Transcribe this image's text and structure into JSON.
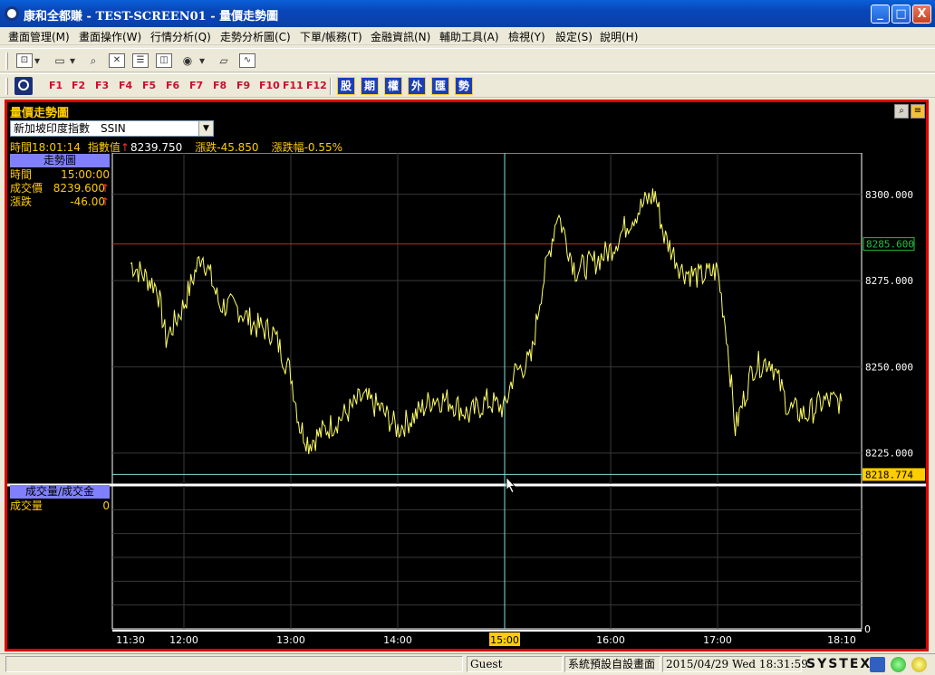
{
  "window": {
    "title": "康和全都賺 - TEST-SCREEN01 - 量價走勢圖",
    "minimize": "_",
    "maximize": "□",
    "close": "X"
  },
  "menu": [
    "畫面管理(M)",
    "畫面操作(W)",
    "行情分析(Q)",
    "走勢分析圖(C)",
    "下單/帳務(T)",
    "金融資訊(N)",
    "輔助工具(A)",
    "檢視(Y)",
    "設定(S)",
    "說明(H)"
  ],
  "toolbar2": {
    "fkeys": [
      "F1",
      "F2",
      "F3",
      "F4",
      "F5",
      "F6",
      "F7",
      "F8",
      "F9",
      "F10",
      "F11",
      "F12"
    ],
    "cat_buttons": [
      "股",
      "期",
      "權",
      "外",
      "匯",
      "勢"
    ]
  },
  "panel": {
    "title": "量價走勢圖",
    "symbol": "新加坡印度指數　SSIN",
    "quote": {
      "time": "時間18:01:14",
      "index_label": "指數值",
      "index_value": "8239.750",
      "change": "漲跌-45.850",
      "change_pct": "漲跌幅-0.55%"
    },
    "trend_head": "走勢圖",
    "trend_rows": [
      {
        "k": "時間",
        "v": "15:00:00"
      },
      {
        "k": "成交價",
        "v": "8239.600"
      },
      {
        "k": "漲跌",
        "v": "-46.00"
      }
    ],
    "volume_head": "成交量/成交金",
    "volume_rows": [
      {
        "k": "成交量",
        "v": "0"
      }
    ]
  },
  "chart_data": {
    "type": "line",
    "title": "",
    "x_ticks": [
      "11:30",
      "12:00",
      "13:00",
      "14:00",
      "15:00",
      "16:00",
      "17:00",
      "18:10"
    ],
    "y_ticks": [
      "8300.000",
      "8275.000",
      "8250.000",
      "8225.000"
    ],
    "ylim": [
      8216,
      8312
    ],
    "reference_price": "8285.600",
    "cursor_price": "8218.774",
    "cursor_time": "15:00",
    "volume_axis_label": "0",
    "colors": {
      "price": "#ffff66",
      "reference": "#d02020",
      "cursor": "#80e0e0",
      "grid": "#3a3a3a"
    },
    "x": [
      "11:30",
      "11:45",
      "11:50",
      "12:00",
      "12:10",
      "12:15",
      "12:20",
      "12:30",
      "12:40",
      "12:50",
      "13:00",
      "13:05",
      "13:10",
      "13:20",
      "13:30",
      "13:40",
      "13:50",
      "14:00",
      "14:10",
      "14:20",
      "14:30",
      "14:40",
      "14:50",
      "15:00",
      "15:05",
      "15:15",
      "15:20",
      "15:30",
      "15:40",
      "15:50",
      "16:00",
      "16:10",
      "16:20",
      "16:25",
      "16:30",
      "16:40",
      "16:50",
      "17:00",
      "17:05",
      "17:10",
      "17:20",
      "17:30",
      "17:40",
      "17:50",
      "18:00",
      "18:10"
    ],
    "values": [
      8280,
      8273,
      8258,
      8268,
      8283,
      8276,
      8268,
      8267,
      8262,
      8260,
      8248,
      8233,
      8228,
      8232,
      8236,
      8241,
      8238,
      8232,
      8236,
      8241,
      8240,
      8236,
      8240,
      8238,
      8248,
      8252,
      8270,
      8295,
      8278,
      8280,
      8284,
      8292,
      8298,
      8300,
      8288,
      8278,
      8276,
      8278,
      8260,
      8232,
      8250,
      8252,
      8238,
      8236,
      8240,
      8240
    ]
  }
}
